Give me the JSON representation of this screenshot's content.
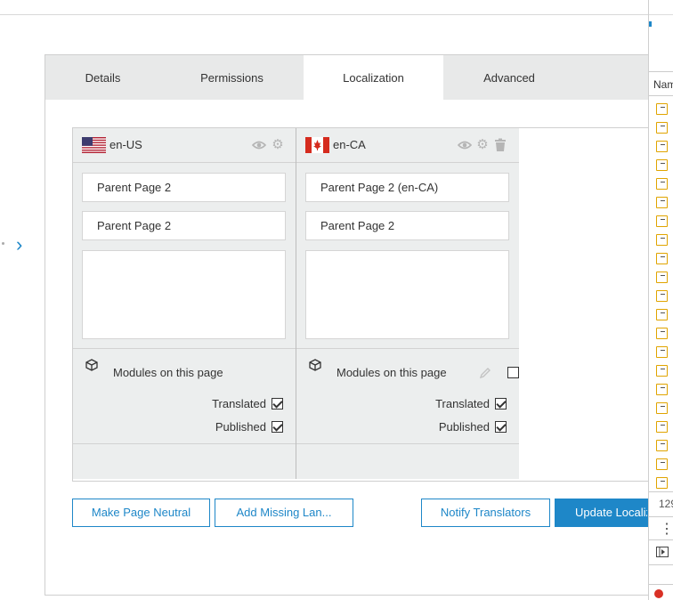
{
  "tabs": [
    {
      "label": "Details"
    },
    {
      "label": "Permissions"
    },
    {
      "label": "Localization"
    },
    {
      "label": "Advanced"
    }
  ],
  "columns": [
    {
      "code": "en-US",
      "fields": [
        "Parent Page 2",
        "Parent Page 2"
      ],
      "modules_label": "Modules on this page",
      "translated_label": "Translated",
      "published_label": "Published"
    },
    {
      "code": "en-CA",
      "fields": [
        "Parent Page 2 (en-CA)",
        "Parent Page 2"
      ],
      "modules_label": "Modules on this page",
      "translated_label": "Translated",
      "published_label": "Published"
    }
  ],
  "buttons": {
    "make_neutral": "Make Page Neutral",
    "add_missing": "Add Missing Lan...",
    "notify": "Notify Translators",
    "update": "Update Localiz"
  },
  "devtools": {
    "header": "Nam",
    "count": "129"
  },
  "colors": {
    "accent": "#1e87c8",
    "tab_bar": "#e8e9e9",
    "column_bg": "#eceeee"
  }
}
